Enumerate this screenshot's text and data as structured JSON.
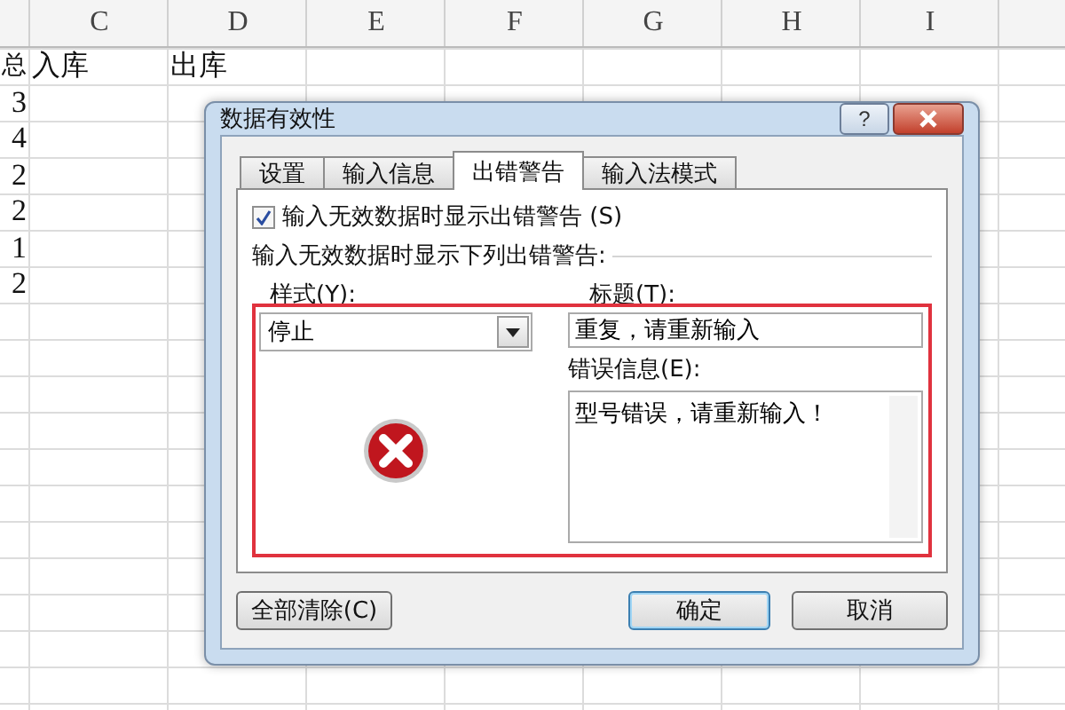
{
  "sheet": {
    "columns": [
      "",
      "C",
      "D",
      "E",
      "F",
      "G",
      "H",
      "I",
      ""
    ],
    "rows": [
      [
        "总",
        "入库",
        "出库"
      ],
      [
        "3"
      ],
      [
        "4"
      ],
      [
        "2"
      ],
      [
        "2"
      ],
      [
        "1"
      ],
      [
        "2"
      ]
    ]
  },
  "dialog": {
    "title": "数据有效性",
    "help_button": "?",
    "tabs": [
      {
        "label": "设置",
        "selected": false
      },
      {
        "label": "输入信息",
        "selected": false
      },
      {
        "label": "出错警告",
        "selected": true
      },
      {
        "label": "输入法模式",
        "selected": false
      }
    ],
    "show_alert": {
      "label": "输入无效数据时显示出错警告 (S)",
      "checked": true
    },
    "section_label": "输入无效数据时显示下列出错警告:",
    "style": {
      "label": "样式(Y):",
      "value": "停止"
    },
    "title_field": {
      "label": "标题(T):",
      "value": "重复，请重新输入"
    },
    "message_field": {
      "label": "错误信息(E):",
      "value": "型号错误，请重新输入！"
    },
    "buttons": [
      {
        "label": "全部清除(C)",
        "kind": "secondary"
      },
      {
        "label": "确定",
        "kind": "default"
      },
      {
        "label": "取消",
        "kind": "secondary"
      }
    ]
  }
}
